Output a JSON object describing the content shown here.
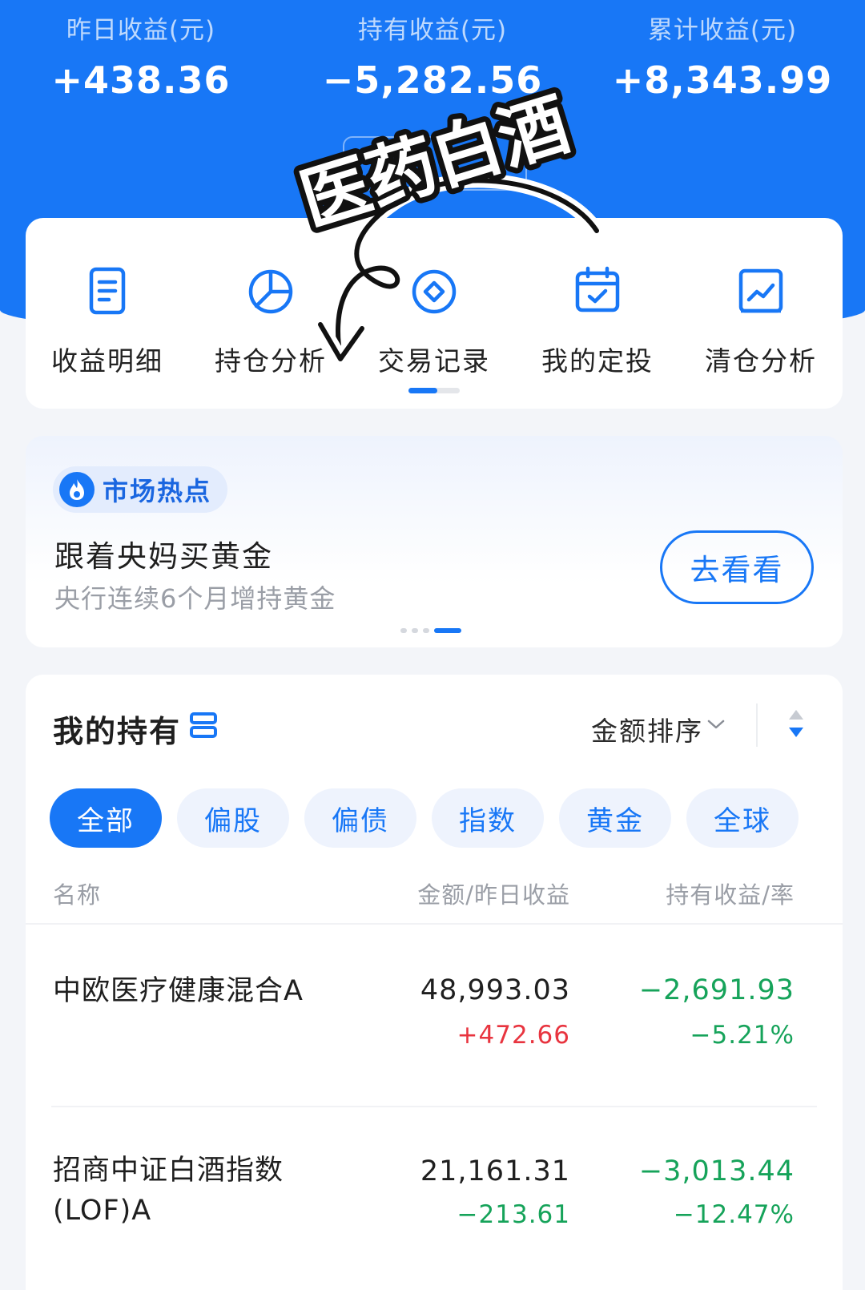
{
  "summary": {
    "yesterday": {
      "label": "昨日收益(元)",
      "value": "+438.36"
    },
    "holding": {
      "label": "持有收益(元)",
      "value": "−5,282.56"
    },
    "cumulative": {
      "label": "累计收益(元)",
      "value": "+8,343.99"
    }
  },
  "overlay_text": "医药白酒",
  "nav": {
    "items": [
      {
        "label": "收益明细",
        "icon": "document-icon"
      },
      {
        "label": "持仓分析",
        "icon": "pie-chart-icon"
      },
      {
        "label": "交易记录",
        "icon": "diamond-circle-icon"
      },
      {
        "label": "我的定投",
        "icon": "calendar-check-icon"
      },
      {
        "label": "清仓分析",
        "icon": "line-chart-icon"
      }
    ]
  },
  "market_hot": {
    "badge": "市场热点",
    "title": "跟着央妈买黄金",
    "subtitle": "央行连续6个月增持黄金",
    "button": "去看看"
  },
  "holdings": {
    "title": "我的持有",
    "sort_label": "金额排序",
    "filters": [
      "全部",
      "偏股",
      "偏债",
      "指数",
      "黄金",
      "全球"
    ],
    "columns": {
      "name": "名称",
      "amount": "金额/昨日收益",
      "profit": "持有收益/率"
    },
    "rows": [
      {
        "name": "中欧医疗健康混合A",
        "amount": "48,993.03",
        "yesterday": "+472.66",
        "profit": "−2,691.93",
        "rate": "−5.21%"
      },
      {
        "name": "招商中证白酒指数(LOF)A",
        "amount": "21,161.31",
        "yesterday": "−213.61",
        "profit": "−3,013.44",
        "rate": "−12.47%"
      }
    ]
  },
  "colors": {
    "brand_blue": "#1877f6",
    "profit_red": "#e8343f",
    "loss_green": "#16a35a"
  }
}
